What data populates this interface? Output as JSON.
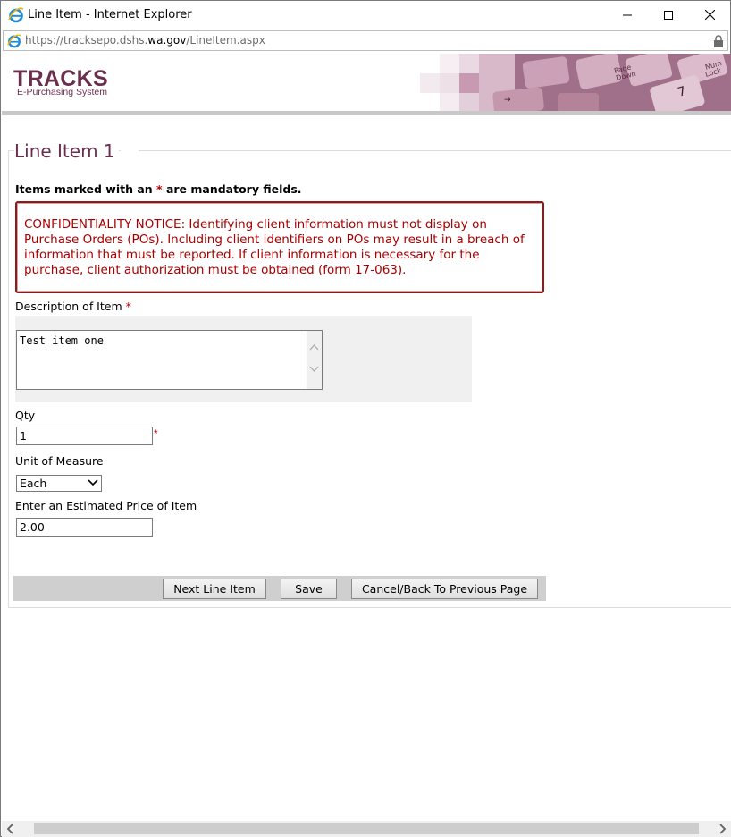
{
  "window": {
    "title": "Line Item - Internet Explorer",
    "url_prefix": "https://tracksepo.dshs.",
    "url_domain": "wa.gov",
    "url_path": "/LineItem.aspx"
  },
  "banner": {
    "logo_title": "TRACKS",
    "logo_subtitle": "E-Purchasing System"
  },
  "form": {
    "legend": "Line Item 1",
    "mandatory_prefix": "Items marked with an ",
    "mandatory_star": "*",
    "mandatory_suffix": " are mandatory fields.",
    "notice": "CONFIDENTIALITY NOTICE: Identifying client information must not display on Purchase Orders (POs). Including client identifiers on POs may result in a breach of information that must be reported. If client information is necessary for the purchase, client authorization must be obtained (form 17-063).",
    "description_label": "Description of Item",
    "description_value": "Test item one",
    "qty_label": "Qty",
    "qty_value": "1",
    "uom_label": "Unit of Measure",
    "uom_value": "Each",
    "price_label": "Enter an Estimated Price of Item",
    "price_value": "2.00",
    "required_marker": "*"
  },
  "actions": {
    "next": "Next Line Item",
    "save": "Save",
    "cancel": "Cancel/Back To Previous Page"
  },
  "colors": {
    "brand": "#6b2f4e",
    "notice_text": "#a80000",
    "required": "#c00000"
  },
  "icons": {
    "ie": "internet-explorer-icon",
    "lock": "lock-icon",
    "minimize": "minimize-icon",
    "maximize": "maximize-icon",
    "close": "close-icon"
  }
}
